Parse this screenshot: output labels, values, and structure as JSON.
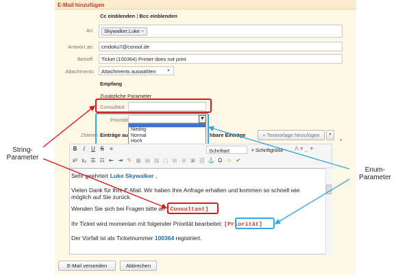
{
  "header": {
    "title": "E-Mail hinzufügen"
  },
  "ccbcc": {
    "cc": "Cc einblenden",
    "sep": " | ",
    "bcc": "Bcc einblenden"
  },
  "to": {
    "label": "An:",
    "recipient": "Skywalker,Luke",
    "remove": "×"
  },
  "reply": {
    "label": "Antwort an:",
    "value": "cmdoku7@consol.de"
  },
  "subject": {
    "label": "Betreff:",
    "value": "Ticket (100364) Printer does not print"
  },
  "attachments": {
    "label": "Attachments",
    "select": "Attachments auswählen"
  },
  "section": {
    "empfang": "Empfang",
    "extra": "Zusätzliche Parameter"
  },
  "consultant": {
    "label": "Consultant",
    "value": ""
  },
  "priority": {
    "label": "Priorität",
    "value": "",
    "options": [
      "Niedrig",
      "Normal",
      "Hoch"
    ]
  },
  "quote": {
    "label": "Zitieren",
    "entries_prefix": "Einträge au",
    "entries_suffix": "hbare Einträge",
    "template_btn": "+ Textvorlage hinzufügen"
  },
  "toolbar": {
    "font": "Schriftart",
    "size": "Schriftgröße"
  },
  "editor": {
    "greet_pre": "Sehr geehrte/r ",
    "greet_name": "Luke Skywalker",
    "greet_post": " ,",
    "p1": "Vielen Dank für Ihre E-Mail. Wir haben Ihre Anfrage erhalten und kommen so schnell wie möglich auf Sie zurück.",
    "p2_pre": "Wenden Sie sich bei Fragen bitte an ",
    "p2_ph": "[Consultant]",
    "p3_pre": "Ihr Ticket wird momentan mit folgender Priorität bearbeitet: ",
    "p3_ph": "[Priorität]",
    "p4_pre": "Der Vorfall ist als Ticketnummer ",
    "p4_num": "100364",
    "p4_post": " registriert."
  },
  "buttons": {
    "send": "E-Mail versenden",
    "cancel": "Abbrechen"
  },
  "annotations": {
    "string": "String-\nParameter",
    "enum": "Enum-\nParameter"
  },
  "colors": {
    "red": "#e0141d",
    "blue": "#35a8e0",
    "header_text": "#c0392b"
  }
}
